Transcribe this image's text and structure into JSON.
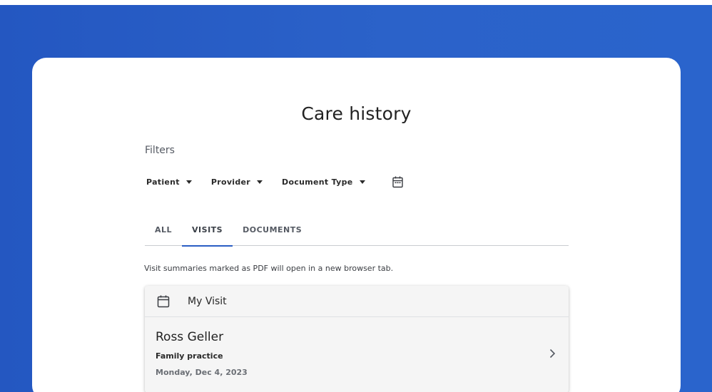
{
  "page": {
    "title": "Care history"
  },
  "filters": {
    "label": "Filters",
    "dropdowns": [
      {
        "label": "Patient"
      },
      {
        "label": "Provider"
      },
      {
        "label": "Document Type"
      }
    ],
    "date_icon": "calendar-icon"
  },
  "tabs": [
    {
      "label": "ALL",
      "active": false
    },
    {
      "label": "VISITS",
      "active": true
    },
    {
      "label": "DOCUMENTS",
      "active": false
    }
  ],
  "notice": "Visit summaries marked as PDF will open in a new browser tab.",
  "visit": {
    "header_icon": "calendar-icon",
    "header_title": "My Visit",
    "provider_name": "Ross Geller",
    "specialty": "Family practice",
    "date": "Monday, Dec 4, 2023",
    "open_icon": "chevron-right-icon"
  },
  "colors": {
    "backdrop": "#2a5ec4",
    "accent": "#2a5ec4",
    "card": "#ffffff"
  }
}
